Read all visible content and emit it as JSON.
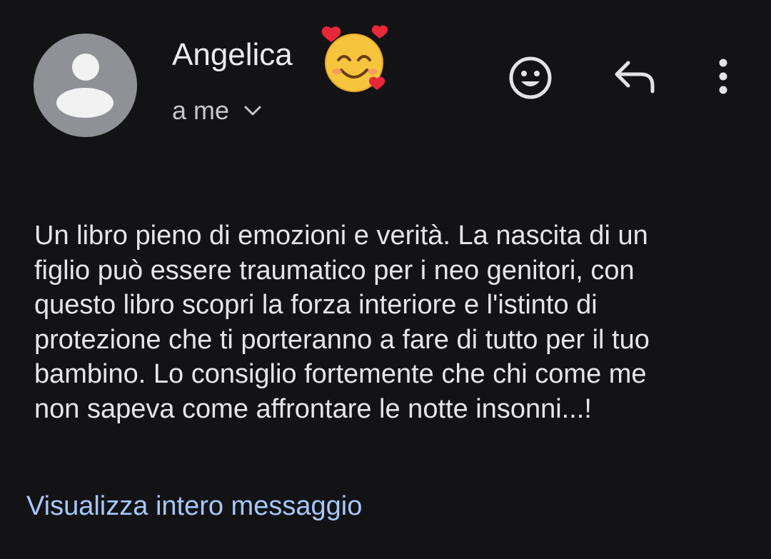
{
  "sender": {
    "name": "Angelica",
    "emoji_icon": "smiling-face-with-hearts-icon",
    "recipient_label": "a me"
  },
  "actions": {
    "react_icon": "smiley-icon",
    "reply_icon": "reply-icon",
    "more_icon": "more-vertical-icon"
  },
  "message": {
    "lines": [
      "Un libro pieno di emozioni e verità. La nascita di un",
      "figlio può essere traumatico per i neo genitori, con",
      "questo libro scopri la forza interiore e l'istinto di",
      "protezione che ti porteranno a fare di tutto per il tuo",
      "bambino. Lo consiglio fortemente che chi come me",
      "non sapeva come affrontare le notte insonni...!"
    ]
  },
  "footer": {
    "view_full_label": "Visualizza intero messaggio"
  },
  "colors": {
    "background": "#131316",
    "text": "#e6e6ea",
    "link": "#a8c7fa",
    "avatar_bg": "#8f9196"
  }
}
